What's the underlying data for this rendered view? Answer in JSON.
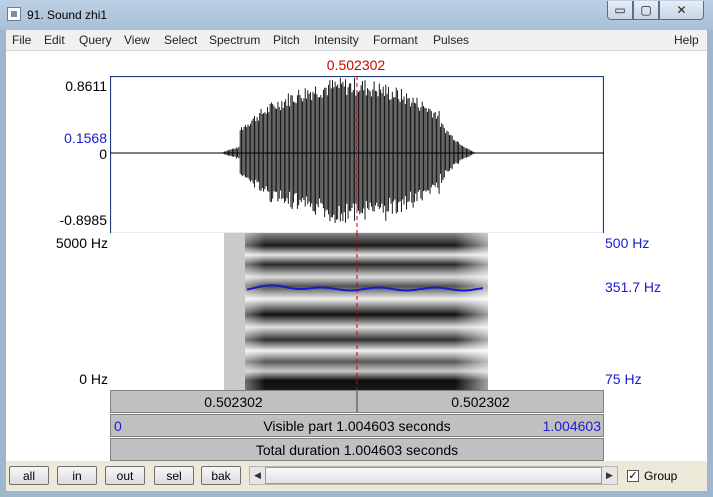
{
  "window": {
    "title": "91. Sound zhi1",
    "minimize_glyph": "▭",
    "maximize_glyph": "▢",
    "close_glyph": "✕"
  },
  "menu": [
    "File",
    "Edit",
    "Query",
    "View",
    "Select",
    "Spectrum",
    "Pitch",
    "Intensity",
    "Formant",
    "Pulses",
    "Help"
  ],
  "cursor": {
    "time_label": "0.502302",
    "color": "#d00000"
  },
  "waveform": {
    "y_max_label": "0.8611",
    "y_cursor_label": "0.1568",
    "y_zero_label": "0",
    "y_min_label": "-0.8985"
  },
  "spectrogram": {
    "freq_max_label": "5000 Hz",
    "freq_min_label": "0 Hz",
    "pitch_max_label": "500 Hz",
    "pitch_cursor_label": "351.7 Hz",
    "pitch_min_label": "75 Hz",
    "pitch_color": "#1a1acc"
  },
  "time_bars": {
    "left_segment": "0.502302",
    "right_segment": "0.502302",
    "window_start": "0",
    "visible_part": "Visible part 1.004603 seconds",
    "window_end": "1.004603",
    "total_duration": "Total duration 1.004603 seconds"
  },
  "buttons": {
    "all": "all",
    "in": "in",
    "out": "out",
    "sel": "sel",
    "bak": "bak"
  },
  "group": {
    "label": "Group",
    "checked": true
  }
}
